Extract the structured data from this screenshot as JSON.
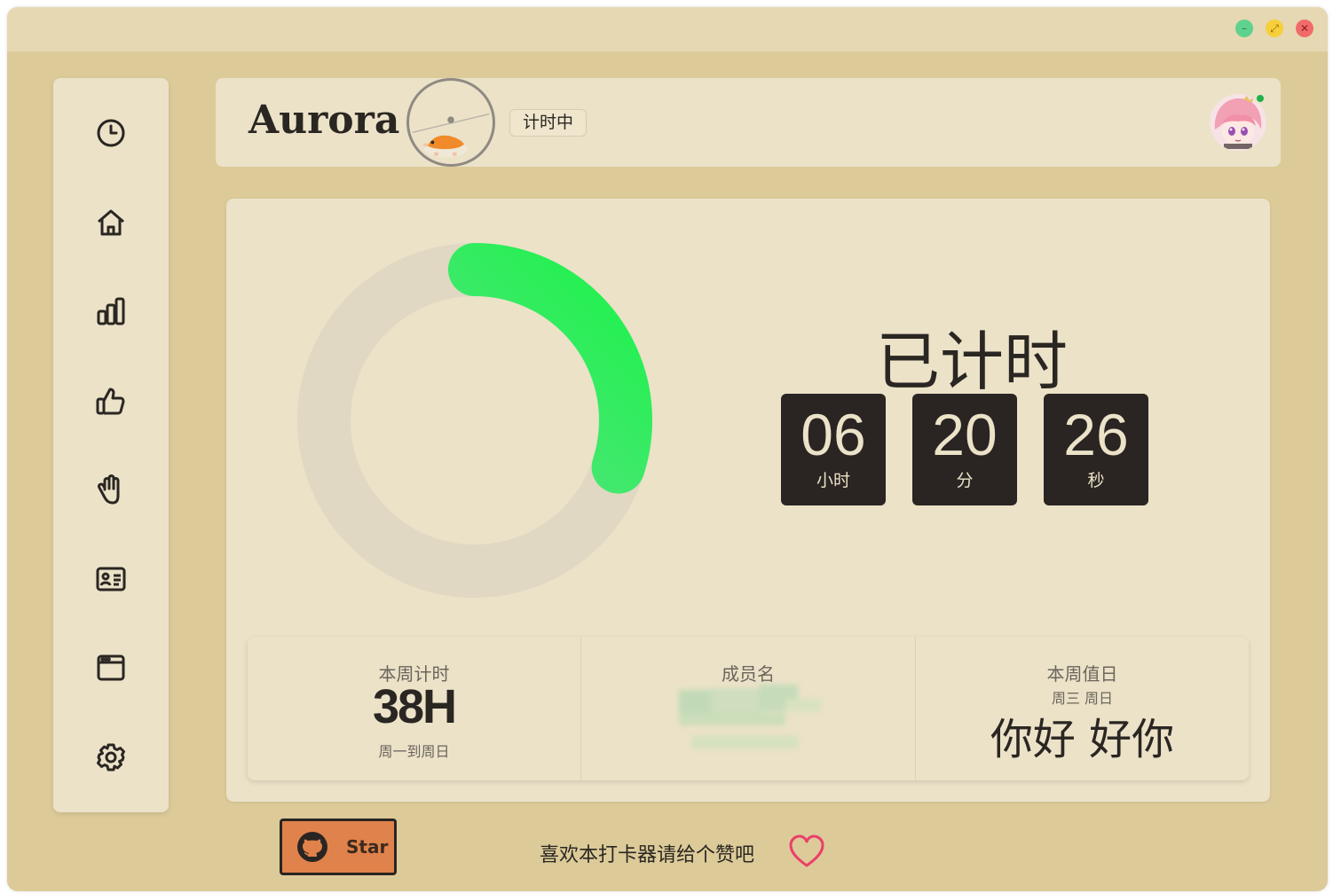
{
  "window": {
    "controls": {
      "minimize": "–",
      "maximize": "⤢",
      "close": "✕"
    },
    "colors": {
      "background": "#dccb99",
      "titlebar": "#e5d8b2",
      "card": "#ebe2c8",
      "ring_track": "#e0d8c2",
      "ring_start": "#7ad8a5",
      "ring_end": "#1ef24b"
    }
  },
  "sidebar": {
    "items": [
      {
        "icon": "clock-icon"
      },
      {
        "icon": "home-icon"
      },
      {
        "icon": "bar-chart-icon"
      },
      {
        "icon": "thumbs-up-icon"
      },
      {
        "icon": "hand-icon"
      },
      {
        "icon": "id-card-icon"
      },
      {
        "icon": "browser-window-icon"
      },
      {
        "icon": "gear-icon"
      }
    ]
  },
  "header": {
    "brand": "Aurora",
    "status": "计时中",
    "avatar_online": true
  },
  "timer": {
    "title": "已计时",
    "hours": "06",
    "hours_unit": "小时",
    "minutes": "20",
    "minutes_unit": "分",
    "seconds": "26",
    "seconds_unit": "秒",
    "progress": 0.3
  },
  "stats": {
    "week": {
      "label": "本周计时",
      "value": "38H",
      "range": "周一到周日"
    },
    "members": {
      "label": "成员名"
    },
    "duty": {
      "label": "本周值日",
      "days": "周三 周日",
      "names": "你好 好你"
    }
  },
  "footer": {
    "star_label": "Star",
    "like_text": "喜欢本打卡器请给个赞吧"
  }
}
